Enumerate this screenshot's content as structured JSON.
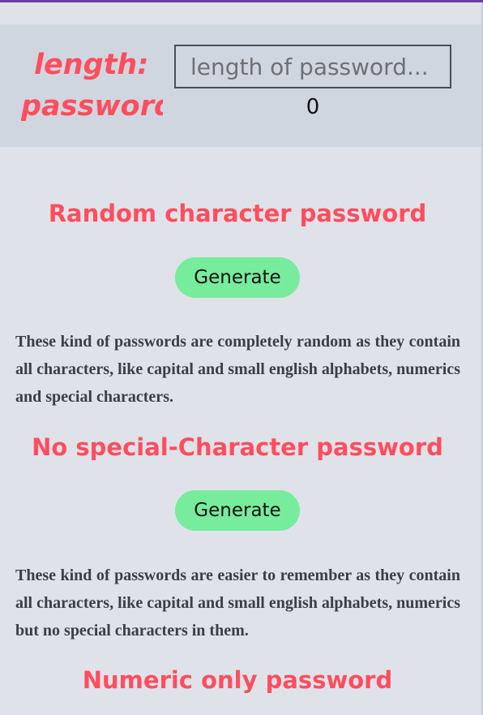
{
  "header": {
    "length_label": "length:",
    "password_label": "password:",
    "length_placeholder": "length of password...",
    "length_value": "",
    "password_value": "0"
  },
  "sections": [
    {
      "title": "Random character password",
      "button_label": "Generate",
      "description": "These kind of passwords are completely random as they contain all characters, like capital and small english alphabets, numerics and special characters."
    },
    {
      "title": "No special-Character password",
      "button_label": "Generate",
      "description": "These kind of passwords are easier to remember as they contain all characters, like capital and small english alphabets, numerics but no special characters in them."
    },
    {
      "title": "Numeric only password"
    }
  ],
  "colors": {
    "accent": "#ff4d5e",
    "button": "#77ec9d",
    "background": "#dfe3e9",
    "header_panel": "#d0d6df",
    "top_border": "#6a3fa0"
  }
}
